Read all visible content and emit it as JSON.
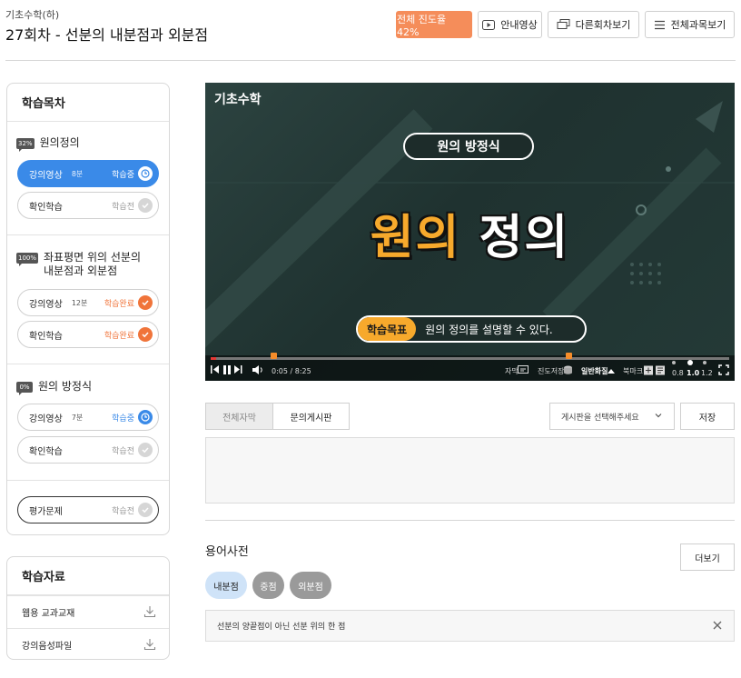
{
  "header": {
    "crumb": "기초수학(하)",
    "title": "27회차 - 선분의 내분점과 외분점",
    "progress_label": "전체 진도율 42%",
    "guide_label": "안내영상",
    "other_label": "다른회차보기",
    "all_label": "전체과목보기"
  },
  "sidebar": {
    "title": "학습목차",
    "sections": [
      {
        "pct": "32%",
        "title": "원의정의",
        "items": [
          {
            "label": "강의영상",
            "duration": "8분",
            "status": "학습중"
          },
          {
            "label": "확인학습",
            "duration": "",
            "status": "학습전"
          }
        ]
      },
      {
        "pct": "100%",
        "title_line1": "좌표평면 위의 선분의",
        "title_line2": "내분점과 외분점",
        "items": [
          {
            "label": "강의영상",
            "duration": "12분",
            "status": "학습완료"
          },
          {
            "label": "확인학습",
            "duration": "",
            "status": "학습완료"
          }
        ]
      },
      {
        "pct": "0%",
        "title": "원의 방정식",
        "items": [
          {
            "label": "강의영상",
            "duration": "7분",
            "status": "학습중"
          },
          {
            "label": "확인학습",
            "duration": "",
            "status": "학습전"
          }
        ]
      }
    ],
    "eval": {
      "label": "평가문제",
      "status": "학습전"
    }
  },
  "resources": {
    "title": "학습자료",
    "items": [
      "웹용 교과교재",
      "강의음성파일"
    ]
  },
  "video": {
    "brand": "기초수학",
    "topic": "원의 방정식",
    "headline_a": "원의",
    "headline_b": "정의",
    "goal_tag": "학습목표",
    "goal_text": "원의 정의를 설명할 수 있다.",
    "time": "0:05 / 8:25",
    "subtitle_label": "자막",
    "progress_save": "진도저장",
    "quality": "일반화질",
    "bookmark": "북마크",
    "speeds": [
      "0.8",
      "1.0",
      "1.2"
    ],
    "played_fraction": 0.01,
    "markers": [
      0.12,
      0.69
    ]
  },
  "tabs": {
    "subtitles": "전체자막",
    "board": "문의게시판",
    "select_placeholder": "게시판을 선택해주세요",
    "save": "저장"
  },
  "dictionary": {
    "title": "용어사전",
    "more": "더보기",
    "chips": [
      "내분점",
      "중점",
      "외분점"
    ],
    "definition": "선분의 양끝점이 아닌 선분 위의 한 점"
  },
  "colors": {
    "accent_orange": "#f58d5a",
    "accent_blue": "#3a8ae8",
    "done_orange": "#f0743a"
  }
}
